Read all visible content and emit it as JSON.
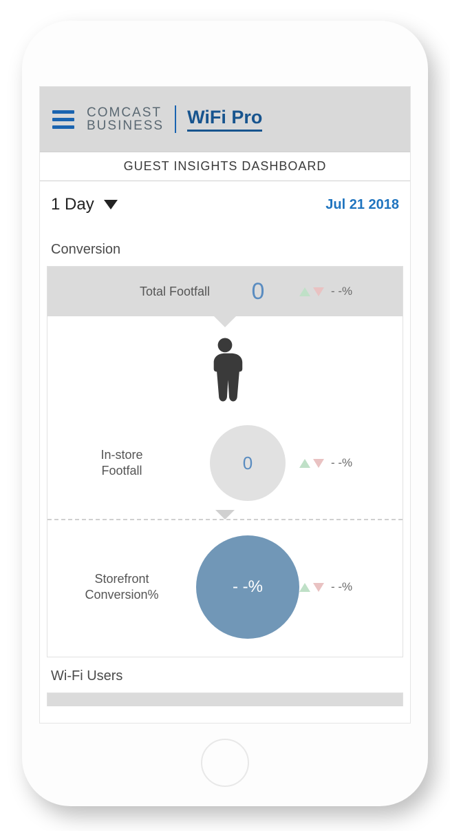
{
  "header": {
    "brand_line1": "COMCAST",
    "brand_line2": "BUSINESS",
    "product": "WiFi Pro"
  },
  "page_title": "GUEST INSIGHTS DASHBOARD",
  "controls": {
    "range": "1 Day",
    "date": "Jul 21 2018"
  },
  "conversion": {
    "section_label": "Conversion",
    "total_footfall": {
      "label": "Total Footfall",
      "value": "0",
      "delta": "- -%"
    },
    "instore": {
      "label_line1": "In-store",
      "label_line2": "Footfall",
      "value": "0",
      "delta": "- -%"
    },
    "storefront": {
      "label_line1": "Storefront",
      "label_line2": "Conversion%",
      "value": "- -%",
      "delta": "- -%"
    }
  },
  "wifi_users": {
    "section_label": "Wi-Fi Users"
  }
}
